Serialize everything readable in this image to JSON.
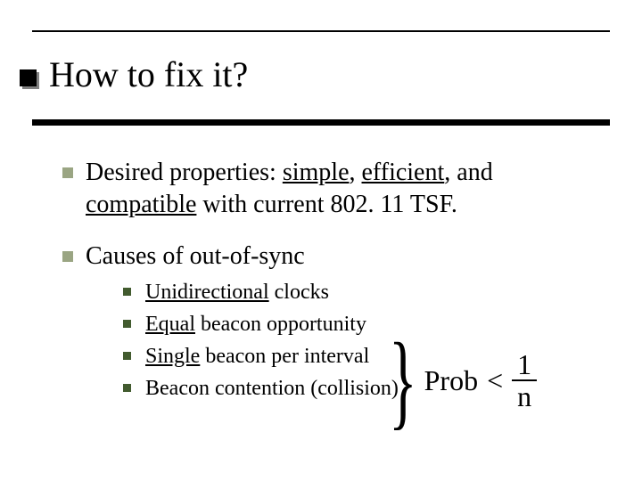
{
  "title": "How to fix it?",
  "points": {
    "p1": {
      "pre": "Desired properties: ",
      "u1": "simple",
      "mid1": ", ",
      "u2": "efficient",
      "mid2": ", and ",
      "u3": "compatible",
      "post": " with current 802. 11 TSF."
    },
    "p2": {
      "text": "Causes of out-of-sync",
      "sub": [
        {
          "u": "Unidirectional",
          "rest": " clocks"
        },
        {
          "u": "Equal",
          "rest": " beacon opportunity"
        },
        {
          "u": "Single",
          "rest": " beacon per interval"
        },
        {
          "u": "",
          "rest": "Beacon contention (collision)"
        }
      ]
    }
  },
  "formula": {
    "lhs": "Prob",
    "op": "<",
    "num": "1",
    "den": "n"
  }
}
